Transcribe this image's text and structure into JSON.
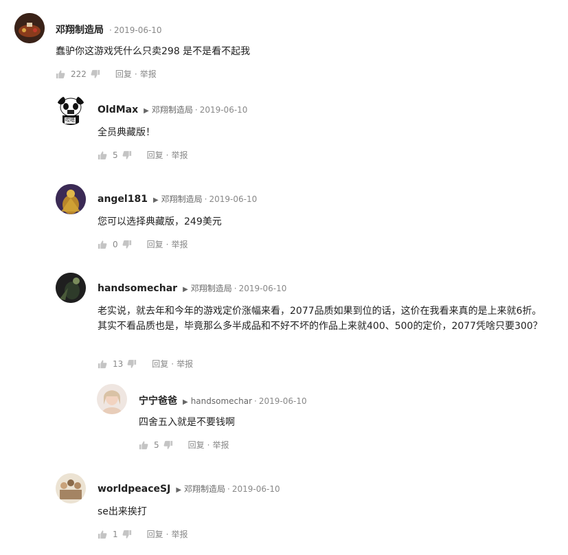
{
  "comments": [
    {
      "author": "邓翔制造局",
      "reply_to": "",
      "date": "2019-06-10",
      "text": "蠢驴你这游戏凭什么只卖298 是不是看不起我",
      "likes": "222",
      "reply_label": "回复",
      "report_label": "举报",
      "avatar_icon": "avatar-gamepad"
    },
    {
      "author": "OldMax",
      "reply_to": "邓翔制造局",
      "date": "2019-06-10",
      "text": "全员典藏版！",
      "likes": "5",
      "reply_label": "回复",
      "report_label": "举报",
      "avatar_icon": "avatar-panda-meme",
      "avatar_caption": "哎嗯"
    },
    {
      "author": "angel181",
      "reply_to": "邓翔制造局",
      "date": "2019-06-10",
      "text": "您可以选择典藏版，249美元",
      "likes": "0",
      "reply_label": "回复",
      "report_label": "举报",
      "avatar_icon": "avatar-golden-figure"
    },
    {
      "author": "handsomechar",
      "reply_to": "邓翔制造局",
      "date": "2019-06-10",
      "text": "老实说，就去年和今年的游戏定价涨幅来看，2077品质如果到位的话，这价在我看来真的是上来就6折。其实不看品质也是，毕竟那么多半成品和不好不坏的作品上来就400、500的定价，2077凭啥只要300？",
      "likes": "13",
      "reply_label": "回复",
      "report_label": "举报",
      "avatar_icon": "avatar-dark-figure"
    },
    {
      "author": "宁宁爸爸",
      "reply_to": "handsomechar",
      "date": "2019-06-10",
      "text": "四舍五入就是不要钱啊",
      "likes": "5",
      "reply_label": "回复",
      "report_label": "举报",
      "avatar_icon": "avatar-portrait"
    },
    {
      "author": "worldpeaceSJ",
      "reply_to": "邓翔制造局",
      "date": "2019-06-10",
      "text": "se出来挨打",
      "likes": "1",
      "reply_label": "回复",
      "report_label": "举报",
      "avatar_icon": "avatar-sketch-group"
    }
  ],
  "colors": {
    "text": "#222222",
    "meta": "#888888",
    "icon": "#bbbbbb"
  }
}
